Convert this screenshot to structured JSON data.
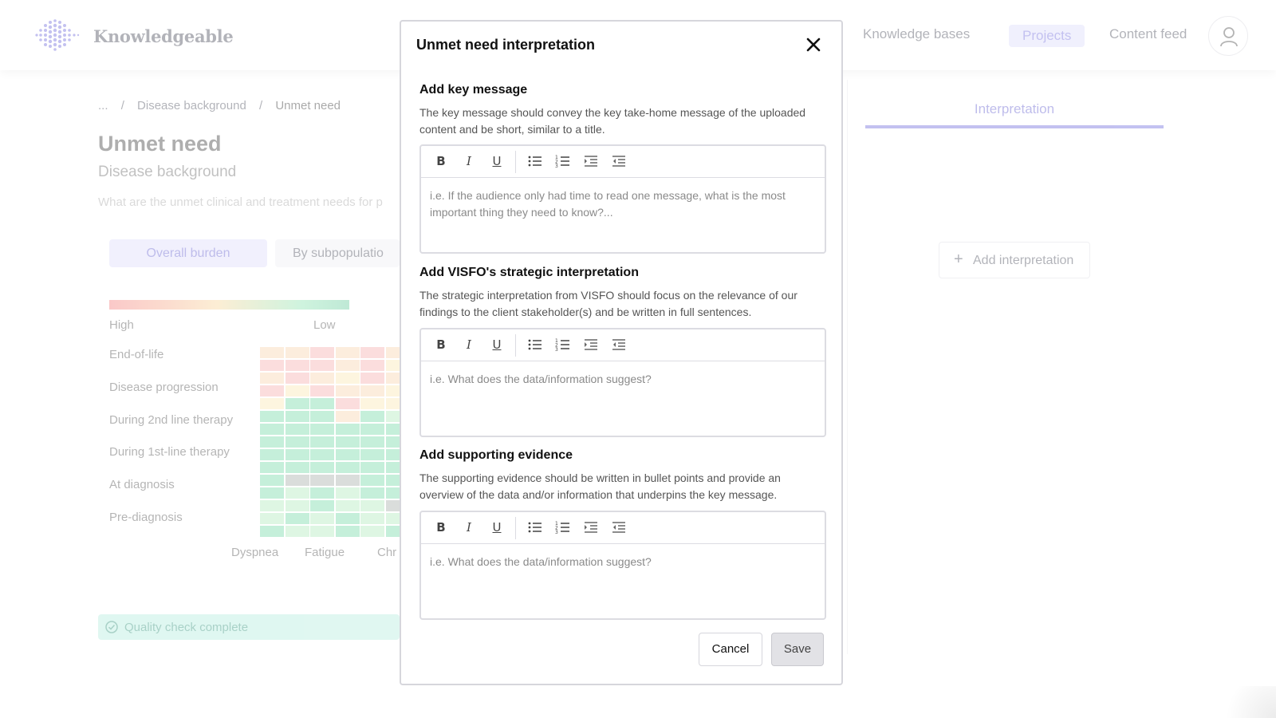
{
  "app": {
    "brand": "Knowledgeable",
    "nav": {
      "kb": "Knowledge bases",
      "projects": "Projects",
      "feed": "Content feed"
    }
  },
  "breadcrumb": {
    "ellipsis": "...",
    "sep": "/",
    "parent": "Disease background",
    "current": "Unmet need"
  },
  "page": {
    "title": "Unmet need",
    "subtitle": "Disease background",
    "question": "What are the unmet clinical and treatment needs for p"
  },
  "tabs": {
    "overall": "Overall burden",
    "subpop": "By subpopulatio"
  },
  "heatmap": {
    "legend_high": "High",
    "legend_low": "Low",
    "rows": [
      "End-of-life",
      "Disease progression",
      "During 2nd line therapy",
      "During 1st-line therapy",
      "At diagnosis",
      "Pre-diagnosis"
    ],
    "cols": [
      "Dyspnea",
      "Fatigue",
      "Chr"
    ],
    "colors": {
      "red": "#f6a3a3",
      "peach": "#f9cfa3",
      "yellow": "#fbe6a8",
      "green": "#62d39a",
      "light_green": "#a6e8b4",
      "gray": "#9aa39e"
    }
  },
  "quality_check": "Quality check complete",
  "right_panel": {
    "tab": "Interpretation",
    "add_button": "Add interpretation"
  },
  "modal": {
    "title": "Unmet need interpretation",
    "sections": [
      {
        "title": "Add key message",
        "description": "The key message should convey the key take-home message of the uploaded content and be short, similar to a title.",
        "placeholder": "i.e. If the audience only had time to read one message, what is the most important thing they need to know?..."
      },
      {
        "title": "Add VISFO's strategic interpretation",
        "description": "The strategic interpretation from VISFO should focus on the relevance of our findings to the client stakeholder(s) and be written in full sentences.",
        "placeholder": "i.e. What does the data/information suggest?"
      },
      {
        "title": "Add supporting evidence",
        "description": "The supporting evidence should be written in bullet points and provide an overview of the data and/or information that underpins the key message.",
        "placeholder": "i.e. What does the data/information suggest?"
      }
    ],
    "toolbar": {
      "bold": "B",
      "italic": "I",
      "underline": "U"
    },
    "cancel": "Cancel",
    "save": "Save"
  }
}
